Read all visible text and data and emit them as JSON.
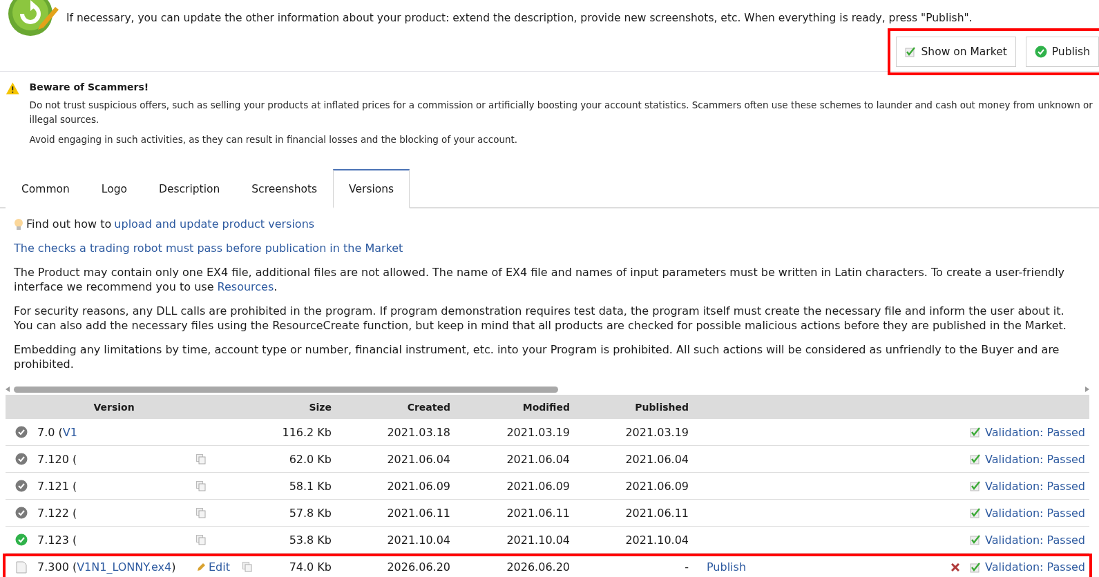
{
  "intro": {
    "text": "If necessary, you can update the other information about your product: extend the description, provide new screenshots, etc. When everything is ready, press \"Publish\".",
    "highlighted": true,
    "buttons": [
      {
        "kind": "market",
        "label": "Show on Market",
        "checked": true
      },
      {
        "kind": "publish",
        "label": "Publish"
      }
    ]
  },
  "warning": {
    "title": "Beware of Scammers!",
    "paragraphs": [
      "Do not trust suspicious offers, such as selling your products at inflated prices for a commission or artificially boosting your account statistics. Scammers often use these schemes to launder and cash out money from unknown or illegal sources.",
      "Avoid engaging in such activities, as they can result in financial losses and the blocking of your account."
    ]
  },
  "tabs": [
    {
      "label": "Common",
      "selected": false
    },
    {
      "label": "Logo",
      "selected": false
    },
    {
      "label": "Description",
      "selected": false
    },
    {
      "label": "Screenshots",
      "selected": false
    },
    {
      "label": "Versions",
      "selected": true
    }
  ],
  "tip": {
    "text": "Find out how to",
    "link": "upload and update product versions"
  },
  "checks_link": "The checks a trading robot must pass before publication in the Market",
  "paragraphs": [
    {
      "text": "The Product may contain only one EX4 file, additional files are not allowed. The name of EX4 file and names of input parameters must be written in Latin characters. To create a user-friendly interface we recommend you to use",
      "link": "Resources",
      "end": "."
    },
    {
      "text": "For security reasons, any DLL calls are prohibited in the program. If program demonstration requires test data, the program itself must create the necessary file and inform the user about it. You can also add the necessary files using the ResourceCreate function, but keep in mind that all products are checked for possible malicious actions before they are published in the Market."
    },
    {
      "text": "Embedding any limitations by time, account type or number, financial instrument, etc. into your Program is prohibited. All such actions will be considered as unfriendly to the Buyer and are prohibited."
    }
  ],
  "table": {
    "columns": [
      "Version",
      "Size",
      "Created",
      "Modified",
      "Published"
    ],
    "rows": [
      {
        "kind": "passed",
        "version": "7.0 (",
        "file": "V1",
        "copy": false,
        "size": "116.2 Kb",
        "created": "2021.03.18",
        "modified": "2021.03.19",
        "published": "2021.03.19",
        "validation": "Validation: Passed",
        "validated": true,
        "highlighted": false
      },
      {
        "kind": "passed",
        "version": "7.120 (",
        "copy": true,
        "size": "62.0 Kb",
        "created": "2021.06.04",
        "modified": "2021.06.04",
        "published": "2021.06.04",
        "validation": "Validation: Passed",
        "validated": true,
        "highlighted": false
      },
      {
        "kind": "passed",
        "version": "7.121 (",
        "copy": true,
        "size": "58.1 Kb",
        "created": "2021.06.09",
        "modified": "2021.06.09",
        "published": "2021.06.09",
        "validation": "Validation: Passed",
        "validated": true,
        "highlighted": false
      },
      {
        "kind": "passed",
        "version": "7.122 (",
        "copy": true,
        "size": "57.8 Kb",
        "created": "2021.06.11",
        "modified": "2021.06.11",
        "published": "2021.06.11",
        "validation": "Validation: Passed",
        "validated": true,
        "highlighted": false
      },
      {
        "kind": "current",
        "version": "7.123 (",
        "copy": true,
        "size": "53.8 Kb",
        "created": "2021.10.04",
        "modified": "2021.10.04",
        "published": "2021.10.04",
        "validation": "Validation: Passed",
        "validated": true,
        "highlighted": false
      },
      {
        "kind": "draft",
        "version": "7.300 (",
        "file": "V1N1_LONNY.ex4",
        "suffix": ")",
        "edit": "Edit",
        "copy": true,
        "size": "74.0 Kb",
        "created": "2026.06.20",
        "modified": "2026.06.20",
        "published": "-",
        "publish": "Publish",
        "deletable": true,
        "validation": "Validation: Passed",
        "validated": true,
        "highlighted": true
      }
    ]
  }
}
